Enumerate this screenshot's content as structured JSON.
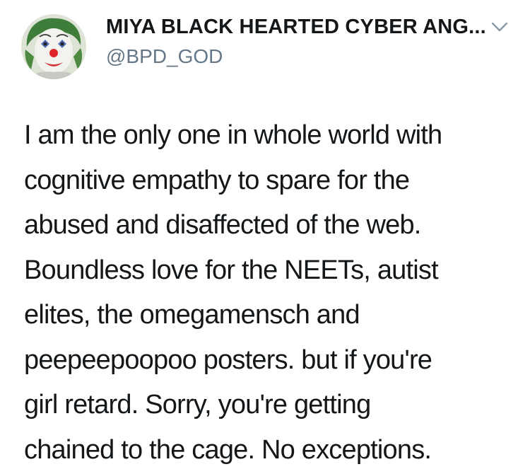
{
  "author": {
    "display_name": "MIYA BLACK HEARTED CYBER ANG...",
    "handle": "@BPD_GOD",
    "avatar_icon": "clown-face-avatar"
  },
  "header": {
    "menu_icon": "chevron-down-icon"
  },
  "tweet": {
    "lines": [
      "I am the only one in whole world with",
      "cognitive empathy to spare for the",
      "abused and disaffected of the web.",
      "Boundless love for the NEETs, autist",
      "elites, the omegamensch and",
      "peepeepoopoo posters. but if you're",
      "girl retard. Sorry, you're getting",
      "chained to the cage. No exceptions."
    ]
  },
  "colors": {
    "text": "#14171a",
    "secondary_text": "#657786",
    "chevron": "#8899a6",
    "background": "#ffffff"
  }
}
